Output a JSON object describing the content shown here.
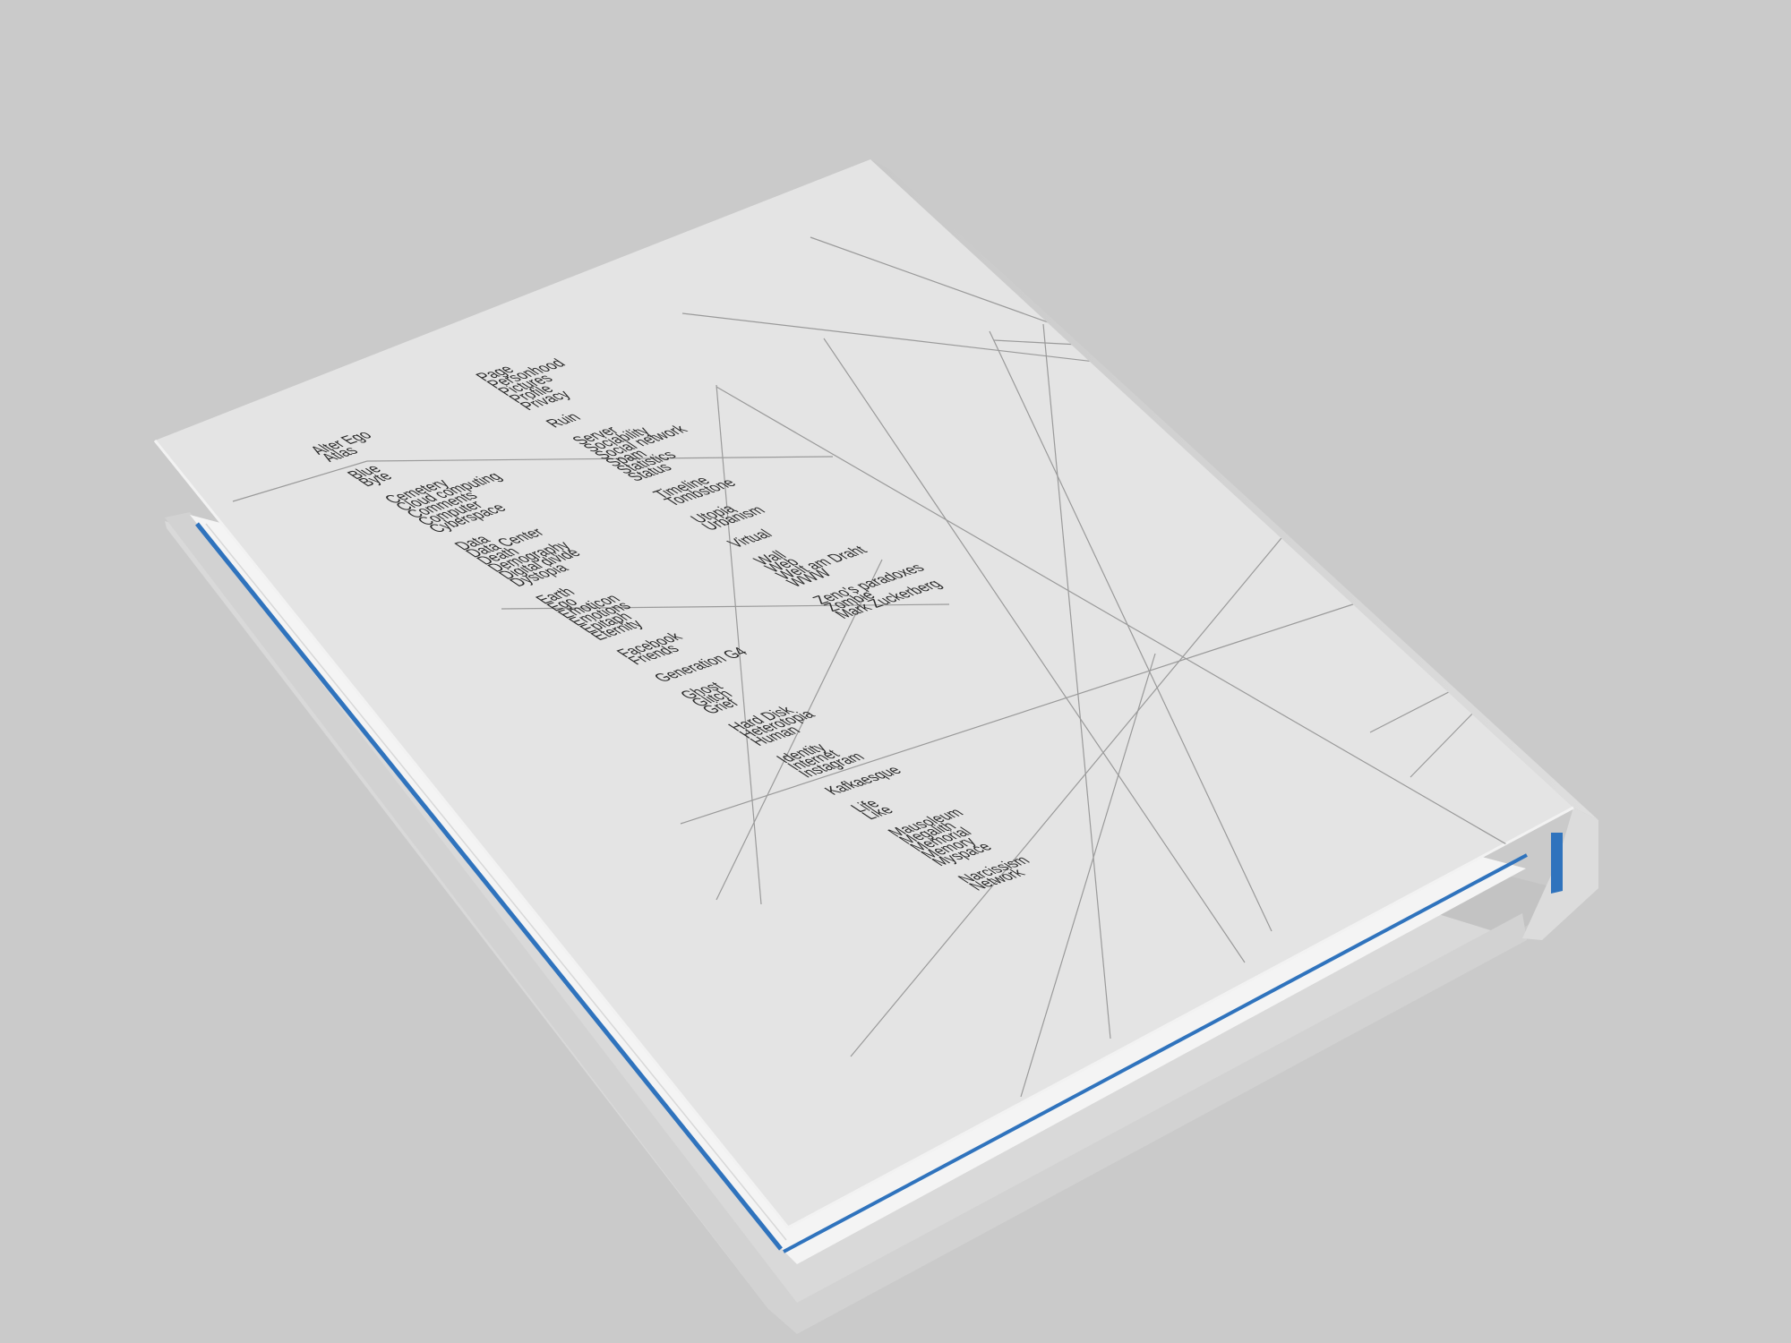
{
  "colors": {
    "background": "#cacaca",
    "cover": "#e4e4e4",
    "spine": "#d8d8d8",
    "page_block": "#f4f4f4",
    "edge_accent": "#2f73bd",
    "line": "#9a9a9a",
    "text": "#2a2a2a"
  },
  "cover": {
    "column_left": [
      [
        "Alter Ego",
        "Atlas"
      ],
      [
        "Blue",
        "Byte"
      ],
      [
        "Cemetery",
        "Cloud computing",
        "Comments",
        "Computer",
        "Cyberspace"
      ],
      [
        "Data",
        "Data Center",
        "Death",
        "Demography",
        "Digital divide",
        "Dystopia"
      ],
      [
        "Earth",
        "Ego",
        "Emoticon",
        "Emotions",
        "Epitaph",
        "Eternity"
      ],
      [
        "Facebook",
        "Friends"
      ],
      [
        "Generation G4"
      ],
      [
        "Ghost",
        "Glitch",
        "Grief"
      ],
      [
        "Hard Disk",
        "Heterotopia",
        "Human"
      ],
      [
        "Identity",
        "Internet",
        "Instagram"
      ],
      [
        "Kafkaesque"
      ],
      [
        "Life",
        "Like"
      ],
      [
        "Mausoleum",
        "Megalith",
        "Memorial",
        "Memory",
        "Myspace"
      ],
      [
        "Narcissism",
        "Network"
      ]
    ],
    "column_right": [
      [
        "Page",
        "Personhood",
        "Pictures",
        "Profile",
        "Privacy"
      ],
      [
        "Ruin"
      ],
      [
        "Server",
        "Sociability",
        "Social network",
        "Spam",
        "Statistics",
        "Status"
      ],
      [
        "Timeline",
        "Tombstone"
      ],
      [
        "Utopia",
        "Urbanism"
      ],
      [
        "Virtual"
      ],
      [
        "Wall",
        "Web",
        "Welt am Draht",
        "WWW"
      ],
      [
        "Zeno's paradoxes",
        "Zombie",
        "Mark Zuckerberg"
      ]
    ]
  }
}
